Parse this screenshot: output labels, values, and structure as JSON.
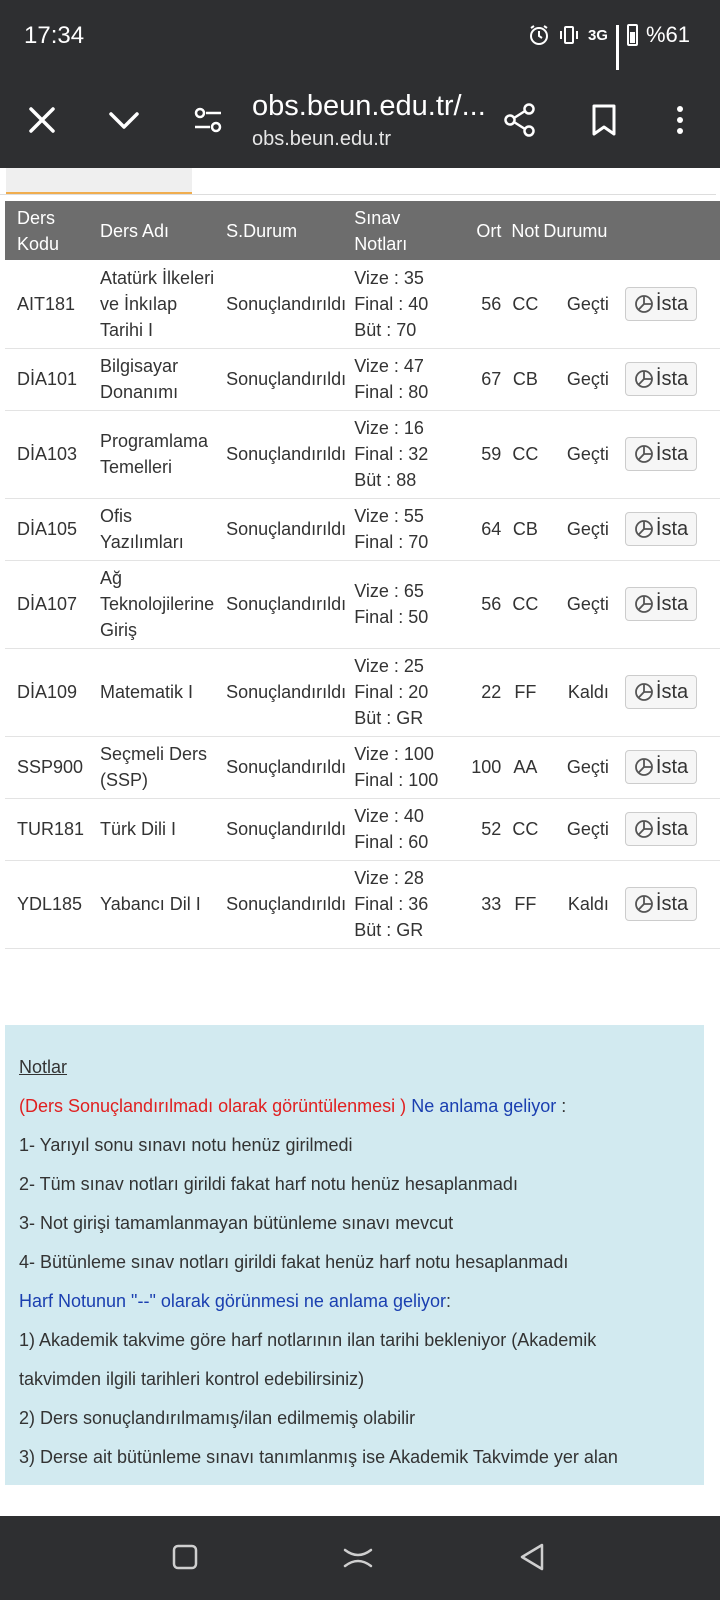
{
  "status_bar": {
    "time": "17:34",
    "network": "3G",
    "battery": "%61"
  },
  "browser": {
    "url_title": "obs.beun.edu.tr/...",
    "url_sub": "obs.beun.edu.tr"
  },
  "table": {
    "headers": {
      "code_1": "Ders",
      "code_2": "Kodu",
      "name": "Ders Adı",
      "status": "S.Durum",
      "exams": "Sınav Notları",
      "avg": "Ort",
      "grade": "Not",
      "result": "Durumu"
    },
    "stat_button_label": "İsta",
    "rows": [
      {
        "code": "AIT181",
        "name": [
          "Atatürk İlkeleri",
          "ve İnkılap",
          "Tarihi I"
        ],
        "status": "Sonuçlandırıldı",
        "exams": [
          "Vize : 35",
          "Final : 40",
          "Büt : 70"
        ],
        "avg": "56",
        "grade": "CC",
        "result": "Geçti"
      },
      {
        "code": "DİA101",
        "name": [
          "Bilgisayar",
          "Donanımı"
        ],
        "status": "Sonuçlandırıldı",
        "exams": [
          "Vize : 47",
          "Final : 80"
        ],
        "avg": "67",
        "grade": "CB",
        "result": "Geçti"
      },
      {
        "code": "DİA103",
        "name": [
          "Programlama",
          "Temelleri"
        ],
        "status": "Sonuçlandırıldı",
        "exams": [
          "Vize : 16",
          "Final : 32",
          "Büt : 88"
        ],
        "avg": "59",
        "grade": "CC",
        "result": "Geçti"
      },
      {
        "code": "DİA105",
        "name": [
          "Ofis",
          "Yazılımları"
        ],
        "status": "Sonuçlandırıldı",
        "exams": [
          "Vize : 55",
          "Final : 70"
        ],
        "avg": "64",
        "grade": "CB",
        "result": "Geçti"
      },
      {
        "code": "DİA107",
        "name": [
          "Ağ",
          "Teknolojilerine",
          "Giriş"
        ],
        "status": "Sonuçlandırıldı",
        "exams": [
          "Vize : 65",
          "Final : 50"
        ],
        "avg": "56",
        "grade": "CC",
        "result": "Geçti"
      },
      {
        "code": "DİA109",
        "name": [
          "Matematik I"
        ],
        "status": "Sonuçlandırıldı",
        "exams": [
          "Vize : 25",
          "Final : 20",
          "Büt : GR"
        ],
        "avg": "22",
        "grade": "FF",
        "result": "Kaldı"
      },
      {
        "code": "SSP900",
        "name": [
          "Seçmeli Ders",
          "(SSP)"
        ],
        "status": "Sonuçlandırıldı",
        "exams": [
          "Vize : 100",
          "Final : 100"
        ],
        "avg": "100",
        "grade": "AA",
        "result": "Geçti"
      },
      {
        "code": "TUR181",
        "name": [
          "Türk Dili I"
        ],
        "status": "Sonuçlandırıldı",
        "exams": [
          "Vize : 40",
          "Final : 60"
        ],
        "avg": "52",
        "grade": "CC",
        "result": "Geçti"
      },
      {
        "code": "YDL185",
        "name": [
          "Yabancı Dil I"
        ],
        "status": "Sonuçlandırıldı",
        "exams": [
          "Vize : 28",
          "Final : 36",
          "Büt : GR"
        ],
        "avg": "33",
        "grade": "FF",
        "result": "Kaldı"
      }
    ]
  },
  "notes": {
    "title": "Notlar",
    "q1_red": "(Ders Sonuçlandırılmadı olarak görüntülenmesi )",
    "q1_blue": "Ne anlama geliyor",
    "q1_suffix": " :",
    "items1": [
      "1- Yarıyıl sonu sınavı notu henüz girilmedi",
      "2- Tüm sınav notları girildi fakat harf notu henüz hesaplanmadı",
      "3- Not girişi tamamlanmayan bütünleme sınavı mevcut",
      "4- Bütünleme sınav notları girildi fakat henüz harf notu hesaplanmadı"
    ],
    "q2_blue": "Harf Notunun \"--\" olarak görünmesi ne anlama geliyor",
    "q2_suffix": ":",
    "items2": [
      "1) Akademik takvime göre harf notlarının ilan tarihi bekleniyor (Akademik",
      "takvimden ilgili tarihleri kontrol edebilirsiniz)",
      "2) Ders sonuçlandırılmamış/ilan edilmemiş olabilir",
      "3) Derse ait bütünleme sınavı tanımlanmış ise Akademik Takvimde yer alan"
    ]
  },
  "colors": {
    "bar_bg": "#2e2f31",
    "table_header": "#6d6d6d",
    "notes_bg": "#d2eaf0",
    "red": "#e02020",
    "blue": "#1a3fb0"
  }
}
